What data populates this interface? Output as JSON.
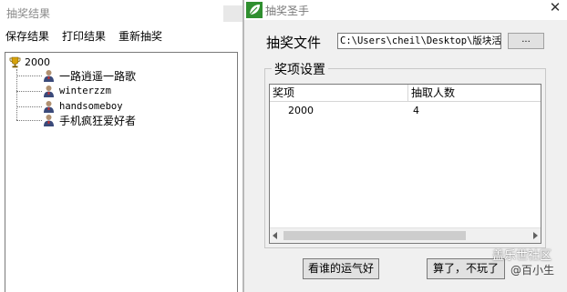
{
  "left_window": {
    "title": "抽奖结果",
    "menu": [
      "保存结果",
      "打印结果",
      "重新抽奖"
    ],
    "tree": {
      "root": "2000",
      "winners": [
        "一路逍遥一路歌",
        "winterzzm",
        "handsomeboy",
        "手机疯狂爱好者"
      ]
    }
  },
  "right_window": {
    "title": "抽奖圣手",
    "file_label": "抽奖文件",
    "file_path": "C:\\Users\\cheil\\Desktop\\版块活",
    "browse_label": "...",
    "group_label": "奖项设置",
    "columns": [
      "奖项",
      "抽取人数"
    ],
    "rows": [
      {
        "prize": "2000",
        "count": "4"
      }
    ],
    "buttons": {
      "luck": "看谁的运气好",
      "quit": "算了，不玩了"
    },
    "close_symbol": "✕"
  },
  "watermark": {
    "line1": "盖乐世社区",
    "line2": "@百小生"
  },
  "colors": {
    "window_bg": "#f0f0f0",
    "button_bg": "#e1e1e1",
    "border": "#7a7a7a",
    "title_gray": "#7a7a7a"
  },
  "icons": {
    "root": "trophy-icon",
    "winner": "person-icon",
    "app": "app-leaf-icon"
  }
}
